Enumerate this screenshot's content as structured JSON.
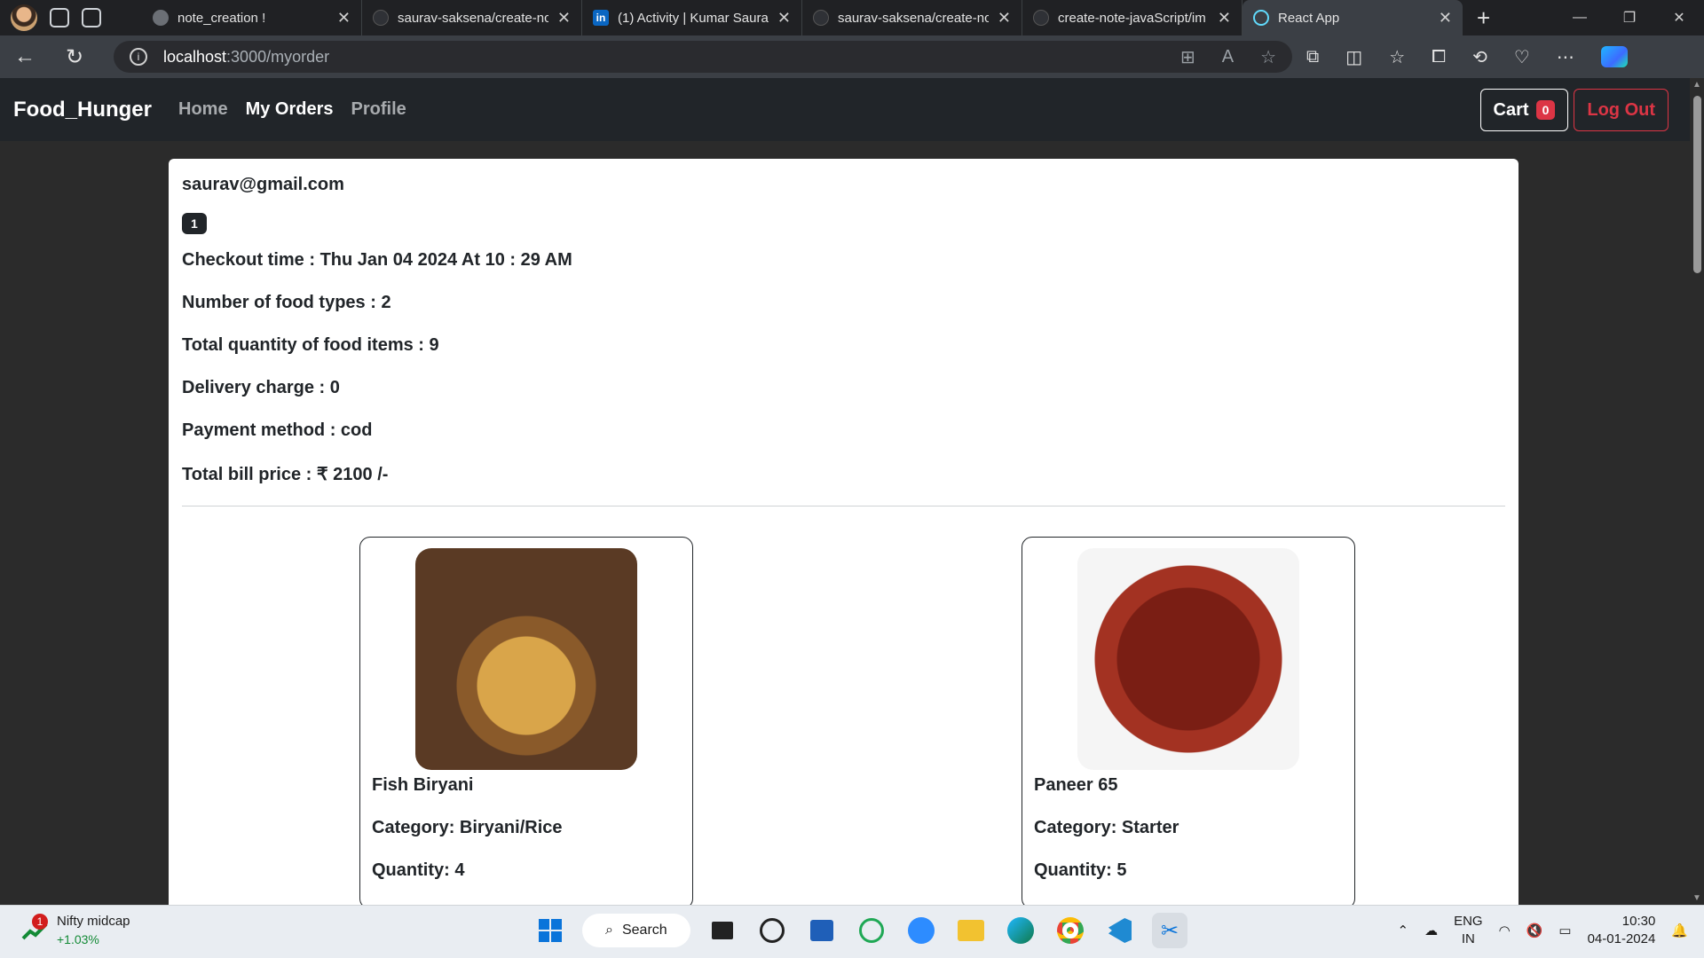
{
  "browser": {
    "tabs": [
      {
        "title": "note_creation !",
        "favicon_color": "#6b6f75",
        "active": false
      },
      {
        "title": "saurav-saksena/create-nc",
        "favicon_color": "#2f3136",
        "active": false
      },
      {
        "title": "(1) Activity | Kumar Saura",
        "favicon_color": "#0a66c2",
        "active": false
      },
      {
        "title": "saurav-saksena/create-nc",
        "favicon_color": "#2f3136",
        "active": false
      },
      {
        "title": "create-note-javaScript/im",
        "favicon_color": "#2f3136",
        "active": false
      },
      {
        "title": "React App",
        "favicon_color": "#61dafb",
        "active": true
      }
    ],
    "linkedin_label": "in",
    "address": {
      "host": "localhost",
      "path": ":3000/myorder"
    }
  },
  "app": {
    "brand": "Food_Hunger",
    "nav": {
      "home": "Home",
      "orders": "My Orders",
      "profile": "Profile"
    },
    "cart_label": "Cart",
    "cart_count": "0",
    "logout_label": "Log Out"
  },
  "order": {
    "email": "saurav@gmail.com",
    "order_number": "1",
    "checkout": "Checkout time : Thu Jan 04 2024 At 10 : 29 AM",
    "food_types": "Number of food types : 2",
    "total_qty": "Total quantity of food items : 9",
    "delivery": "Delivery charge : 0",
    "payment": "Payment method : cod",
    "total": "Total bill price : ₹ 2100 /-",
    "items": [
      {
        "name": "Fish Biryani",
        "category": "Category: Biryani/Rice",
        "quantity": "Quantity: 4"
      },
      {
        "name": "Paneer 65",
        "category": "Category: Starter",
        "quantity": "Quantity: 5"
      }
    ]
  },
  "taskbar": {
    "widget_title": "Nifty midcap",
    "widget_change": "+1.03%",
    "widget_badge": "1",
    "search_label": "Search",
    "lang_top": "ENG",
    "lang_bottom": "IN",
    "time": "10:30",
    "date": "04-01-2024"
  }
}
